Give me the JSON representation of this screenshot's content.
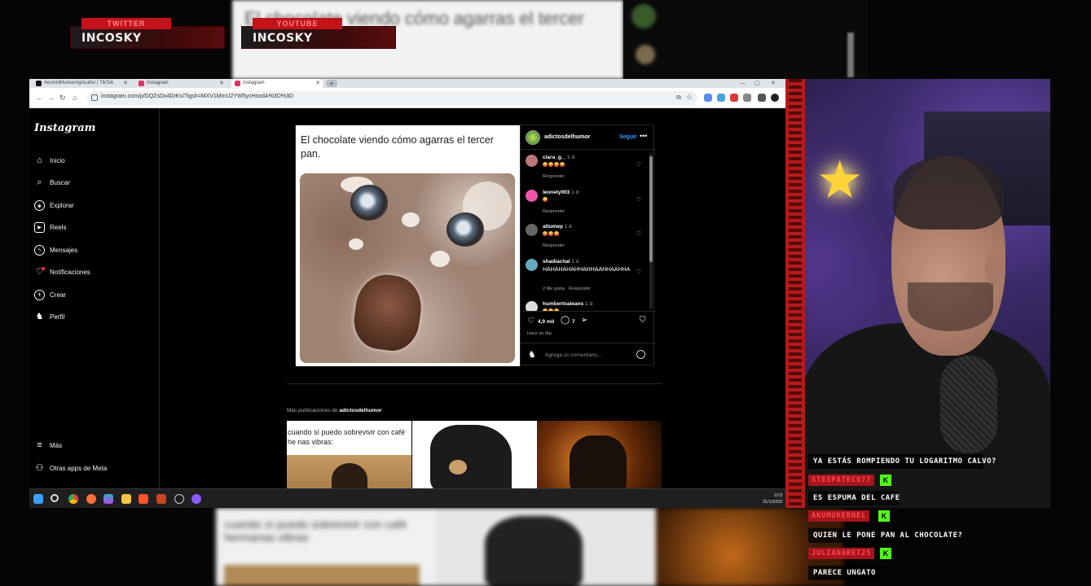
{
  "banners": [
    {
      "tag": "TWITTER",
      "name": "INCOSKY"
    },
    {
      "tag": "YOUTUBE",
      "name": "INCOSKY"
    }
  ],
  "background_echo": {
    "top_text": "El chocolate viendo cómo agarras el tercer",
    "bottom_text": "cuando sí puedo sobrevivir con café hermanas vibras"
  },
  "browser": {
    "tabs": [
      {
        "label": "#esmrdHumorAgricultor | TikTok"
      },
      {
        "label": "Instagram"
      },
      {
        "label": "Instagram"
      }
    ],
    "url": "instagram.com/p/DQZsDx4DrKs/?igsh=MXV1MmU2YW5ycHoxdA%3D%3D",
    "new_tab": "+",
    "window_controls": {
      "minimize": "—",
      "maximize": "▢",
      "close": "✕"
    }
  },
  "instagram": {
    "logo": "Instagram",
    "nav": [
      {
        "label": "Inicio",
        "icon": "home-icon"
      },
      {
        "label": "Buscar",
        "icon": "search-icon"
      },
      {
        "label": "Explorar",
        "icon": "compass-icon"
      },
      {
        "label": "Reels",
        "icon": "reels-icon"
      },
      {
        "label": "Mensajes",
        "icon": "messenger-icon"
      },
      {
        "label": "Notificaciones",
        "icon": "heart-icon"
      },
      {
        "label": "Crear",
        "icon": "plus-icon"
      },
      {
        "label": "Perfil",
        "icon": "profile-icon"
      }
    ],
    "nav_bottom": [
      {
        "label": "Más",
        "icon": "menu-icon"
      },
      {
        "label": "Otras apps de Meta",
        "icon": "meta-apps-icon"
      }
    ],
    "post": {
      "caption": "El chocolate viendo cómo agarras el tercer pan.",
      "author": "adictosdelhumor",
      "follow": "Seguir",
      "more": "•••",
      "comments": [
        {
          "user": "clara_g._",
          "time": "1 d",
          "text": "",
          "reply": "Responder"
        },
        {
          "user": "leonely003",
          "time": "1 d",
          "text": "",
          "reply": "Responder"
        },
        {
          "user": "altumep",
          "time": "1 d",
          "text": "",
          "reply": "Responder"
        },
        {
          "user": "shadiachal",
          "time": "1 d",
          "text": "HAHAHAHAHHAHHAAHHAAHHA",
          "likes": "2 Me gusta",
          "reply": "Responder"
        },
        {
          "user": "humbertoaleans",
          "time": "1 d",
          "text": "",
          "reply": ""
        }
      ],
      "likes": "4,9 mil",
      "comments_count": "7",
      "posted": "Hace un día",
      "comment_placeholder": "Agrega un comentario..."
    },
    "more_posts_label": "Más publicaciones de",
    "more_posts_author": "adictosdelhumor",
    "thumb1_text": "cuando sí puedo sobrevivir con café he nas vibras:"
  },
  "taskbar": {
    "time": "10:5",
    "date": "31/10/202"
  },
  "chat": [
    {
      "type": "msg",
      "text": "YA ESTÁS ROMPIENDO TU LOGARITMO CALVO?"
    },
    {
      "type": "user",
      "text": "STESPATEC077"
    },
    {
      "type": "msg",
      "text": "ES ESPUMA DEL CAFE"
    },
    {
      "type": "user",
      "text": "AKUMUKERNEL"
    },
    {
      "type": "msg",
      "text": "QUIEN LE PONE PAN AL CHOCOLATE?"
    },
    {
      "type": "user",
      "text": "JULIANARET25"
    },
    {
      "type": "msg",
      "text": "PARECE UNGATO"
    }
  ],
  "colors": {
    "accent_red": "#c4121a",
    "kick_green": "#53fc18",
    "ig_blue": "#4096ff"
  }
}
